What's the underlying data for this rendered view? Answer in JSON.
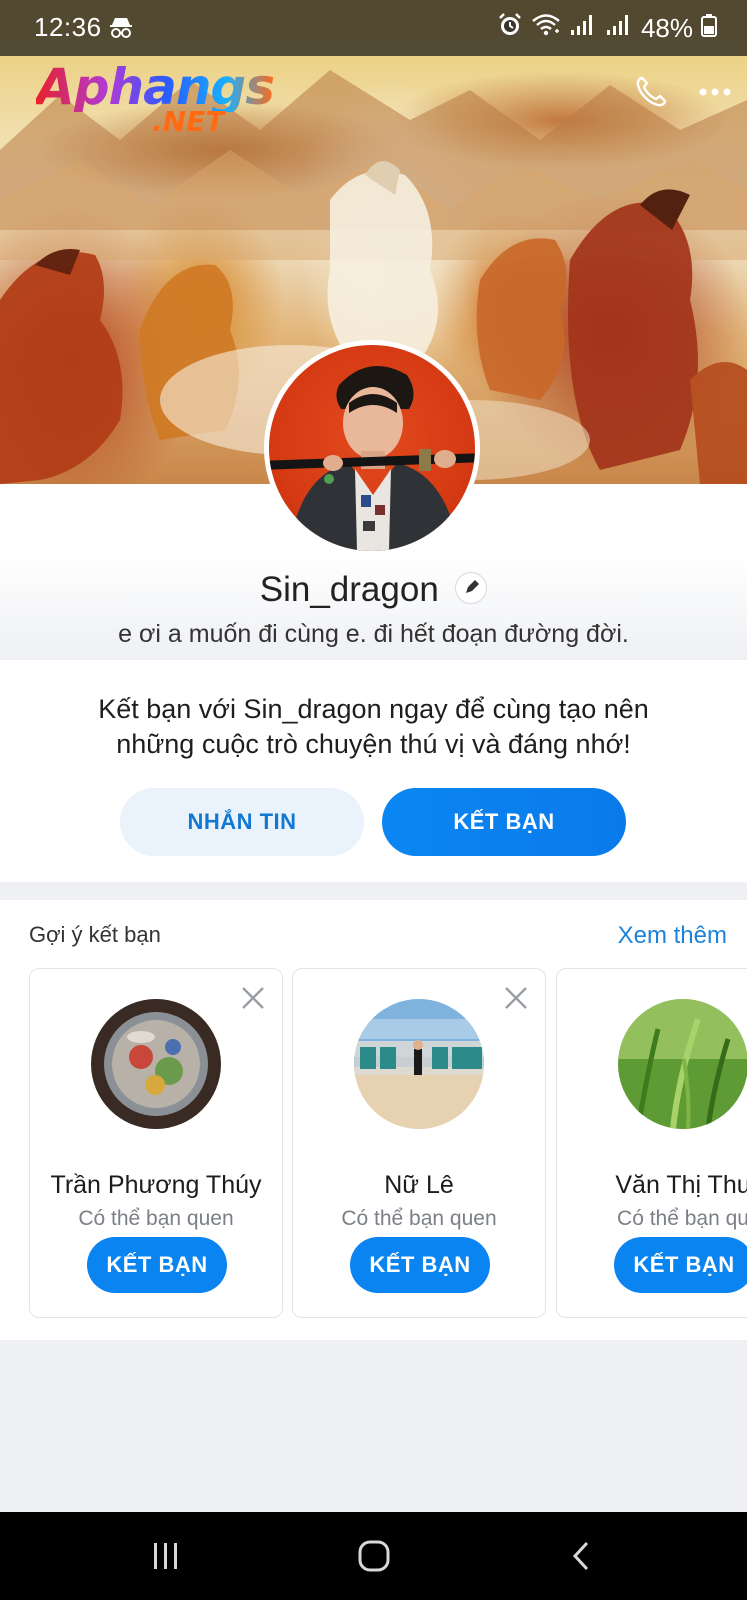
{
  "status_bar": {
    "time": "12:36",
    "battery": "48%"
  },
  "watermark": {
    "top": "Aphangs",
    "bottom": ".NET"
  },
  "profile": {
    "name": "Sin_dragon",
    "status": "e ơi a muốn đi cùng e. đi hết đoạn đường đời."
  },
  "friend_prompt": {
    "line1": "Kết bạn với Sin_dragon ngay để cùng tạo nên",
    "line2": "những cuộc trò chuyện thú vị và đáng nhớ!",
    "message_label": "NHẮN TIN",
    "add_label": "KẾT BẠN"
  },
  "suggestions": {
    "title": "Gợi ý kết bạn",
    "see_more": "Xem thêm",
    "items": [
      {
        "name": "Trần Phương Thúy",
        "subtitle": "Có thể bạn quen",
        "button": "KẾT BẠN"
      },
      {
        "name": "Nữ Lê",
        "subtitle": "Có thể bạn quen",
        "button": "KẾT BẠN"
      },
      {
        "name": "Văn Thị Thu",
        "subtitle": "Có thể bạn qu",
        "button": "KẾT BẠN"
      }
    ]
  },
  "icons": {
    "status": [
      "incognito-icon",
      "alarm-icon",
      "wifi-icon",
      "signal-icon",
      "battery-icon"
    ],
    "header": [
      "phone-icon",
      "more-icon"
    ],
    "nav": [
      "recents-icon",
      "home-icon",
      "back-icon"
    ]
  },
  "colors": {
    "accent": "#0a84f0",
    "link": "#1b84da",
    "message_button_bg": "#eaf3fb"
  }
}
